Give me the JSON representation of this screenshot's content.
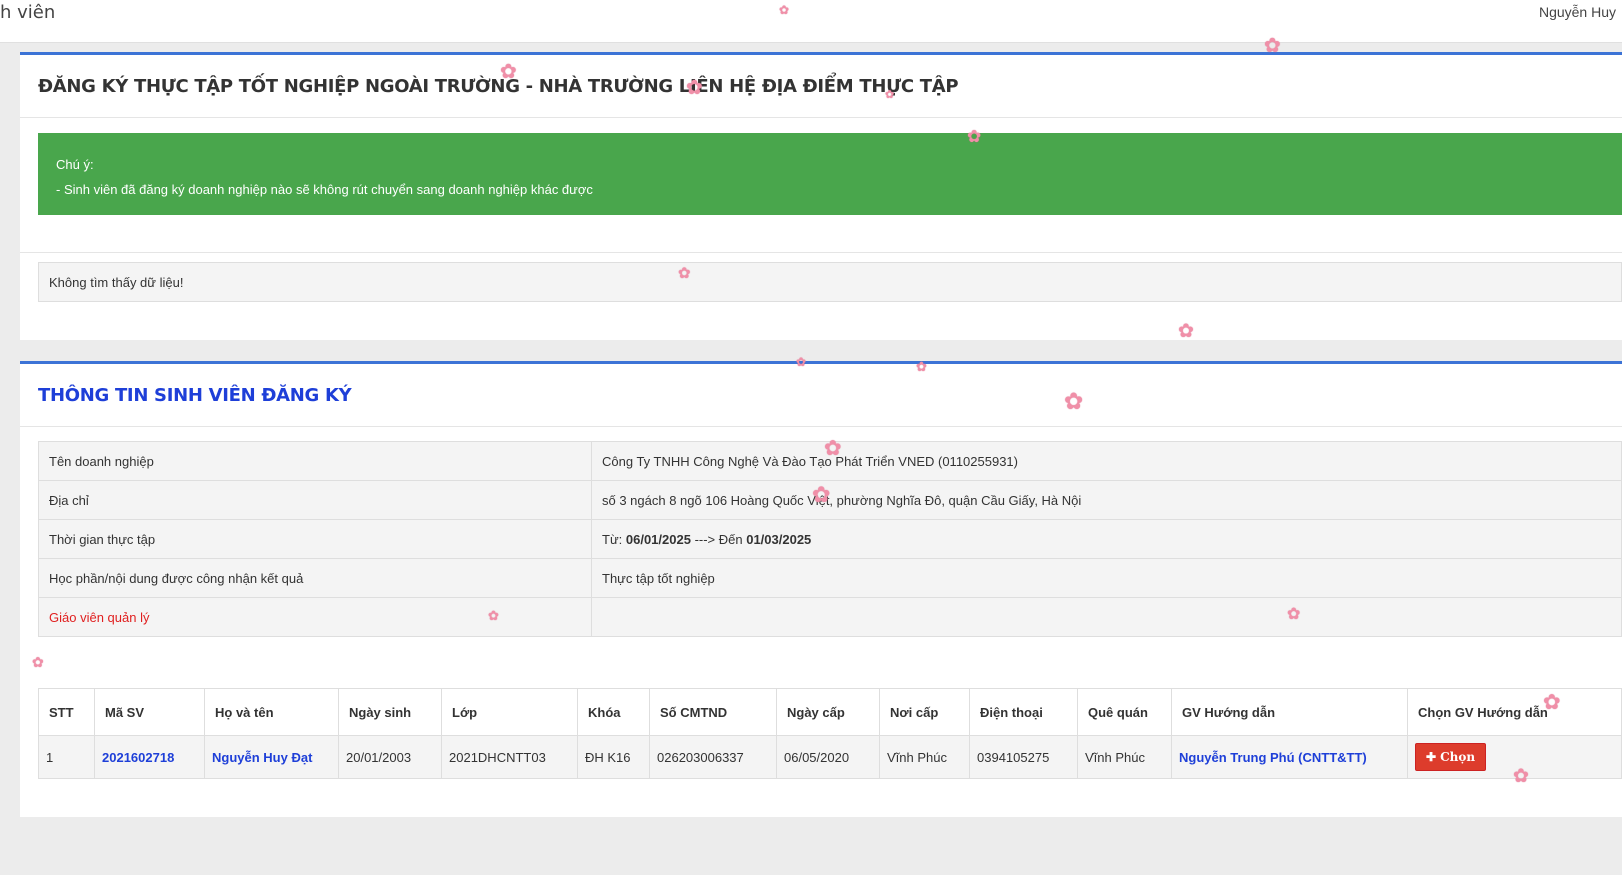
{
  "header": {
    "page_title_cut": "h viên",
    "user_name": "Nguyễn Huy"
  },
  "panel1": {
    "title": "ĐĂNG KÝ THỰC TẬP TỐT NGHIỆP NGOÀI TRƯỜNG - NHÀ TRƯỜNG LIÊN HỆ ĐỊA ĐIỂM THỰC TẬP",
    "notice_title": "Chú ý:",
    "notice_text": "- Sinh viên đã đăng ký doanh nghiệp nào sẽ không rút chuyển sang doanh nghiệp khác được",
    "notice_color": "#49a64c",
    "empty_text": "Không tìm thấy dữ liệu!"
  },
  "panel2": {
    "title": "THÔNG TIN SINH VIÊN ĐĂNG KÝ",
    "info_rows": [
      {
        "label": "Tên doanh nghiệp",
        "value": "Công Ty TNHH Công Nghệ Và Đào Tạo Phát Triển VNED (0110255931)"
      },
      {
        "label": "Địa chỉ",
        "value": "số 3 ngách 8 ngõ 106 Hoàng Quốc Việt, phường Nghĩa Đô, quận Cầu Giấy, Hà Nội"
      },
      {
        "label": "Thời gian thực tập",
        "from_prefix": "Từ: ",
        "from_date": "06/01/2025",
        "to_prefix": " ---> Đến ",
        "to_date": "01/03/2025"
      },
      {
        "label": "Học phần/nội dung được công nhận kết quả",
        "value": "Thực tập tốt nghiệp"
      },
      {
        "label": "Giáo viên quản lý",
        "value": ""
      }
    ],
    "table": {
      "headers": [
        "STT",
        "Mã SV",
        "Họ và tên",
        "Ngày sinh",
        "Lớp",
        "Khóa",
        "Số CMTND",
        "Ngày cấp",
        "Nơi cấp",
        "Điện thoại",
        "Quê quán",
        "GV Hướng dẫn",
        "Chọn GV Hướng dẫn"
      ],
      "row": {
        "stt": "1",
        "ma_sv": "2021602718",
        "ho_ten": "Nguyễn Huy Đạt",
        "ngay_sinh": "20/01/2003",
        "lop": "2021DHCNTT03",
        "khoa": "ĐH K16",
        "cmtnd": "026203006337",
        "ngay_cap": "06/05/2020",
        "noi_cap": "Vĩnh Phúc",
        "dien_thoai": "0394105275",
        "que_quan": "Vĩnh Phúc",
        "gv_huong_dan": "Nguyễn Trung Phú (CNTT&TT)",
        "chon_button": "Chọn",
        "chon_icon": "plus-icon"
      }
    }
  },
  "colors": {
    "accent_border": "#3c73d6",
    "title_blue": "#1e3fd8",
    "button_red": "#dd3c2c",
    "label_red": "#e02020"
  },
  "decorations": {
    "blossom_icon": "cherry-blossom-icon"
  }
}
